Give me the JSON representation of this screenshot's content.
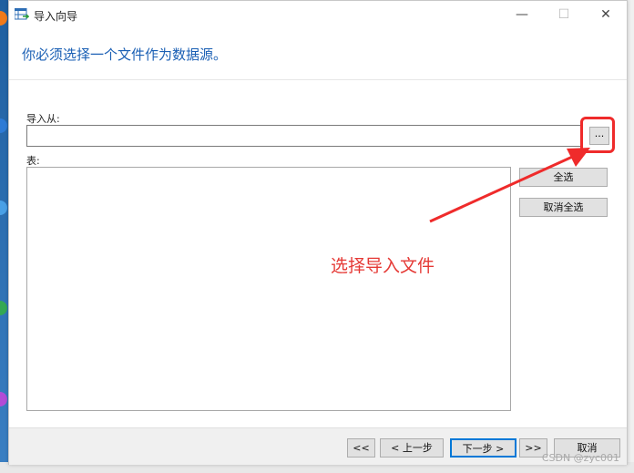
{
  "window": {
    "title": "导入向导",
    "controls": {
      "minimize": "—",
      "maximize": "☐",
      "close": "✕"
    }
  },
  "page": {
    "heading": "你必须选择一个文件作为数据源。"
  },
  "import_from": {
    "label": "导入从:",
    "value": "",
    "browse_label": "..."
  },
  "tables": {
    "label": "表:",
    "select_all": "全选",
    "deselect_all": "取消全选"
  },
  "annotation": {
    "text": "选择导入文件",
    "color": "#e53935"
  },
  "footer": {
    "first": "<<",
    "prev": "< 上一步",
    "next": "下一步 >",
    "last": ">>",
    "cancel": "取消"
  },
  "watermark": "CSDN @zyc001",
  "colors": {
    "accent": "#1a5fb4",
    "highlight": "#ef2b2b"
  }
}
